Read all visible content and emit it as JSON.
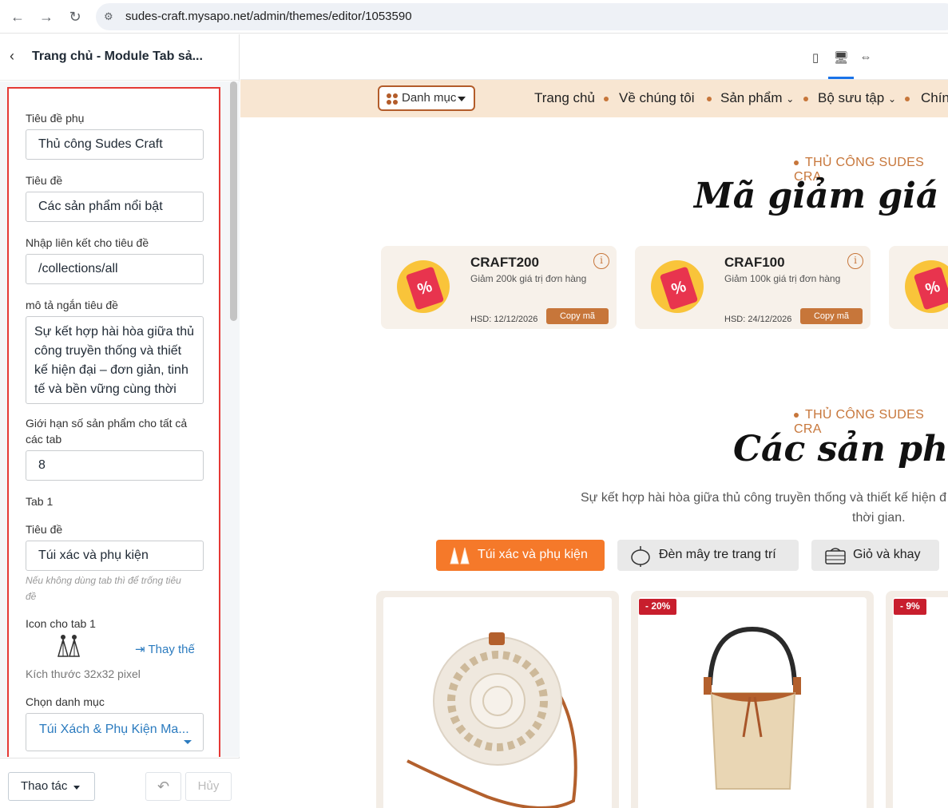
{
  "browser": {
    "url": "sudes-craft.mysapo.net/admin/themes/editor/1053590"
  },
  "panel": {
    "title": "Trang chủ - Module Tab sả...",
    "fields": {
      "subtitle_label": "Tiêu đề phụ",
      "subtitle_value": "Thủ công Sudes Craft",
      "title_label": "Tiêu đề",
      "title_value": "Các sản phẩm nổi bật",
      "link_label": "Nhập liên kết cho tiêu đề",
      "link_value": "/collections/all",
      "desc_label": "mô tả ngắn tiêu đề",
      "desc_value": "Sự kết hợp hài hòa giữa thủ công truyền thống và thiết kế hiện đại – đơn giản, tinh tế và bền vững cùng thời",
      "limit_label_1": "Giới hạn số sản phẩm cho tất cả",
      "limit_label_2": "các tab",
      "limit_value": "8",
      "tab1_heading": "Tab 1",
      "tab1_title_label": "Tiêu đề",
      "tab1_title_value": "Túi xác và phụ kiện",
      "tab1_hint_1": "Nếu không dùng tab thì để trống tiêu",
      "tab1_hint_2": "đề",
      "tab1_icon_label": "Icon cho tab 1",
      "replace_label": "Thay thế",
      "icon_size_hint": "Kích thước 32x32 pixel",
      "category_label": "Chọn danh mục",
      "category_value": "Túi Xách & Phụ Kiện Ma..."
    },
    "footer": {
      "actions_label": "Thao tác",
      "cancel_label": "Hủy"
    }
  },
  "site": {
    "nav": {
      "category_button": "Danh mục",
      "items": [
        "Trang chủ",
        "Về chúng tôi",
        "Sản phẩm",
        "Bộ sưu tập",
        "Chín"
      ]
    },
    "coupon_section": {
      "kicker": "THỦ CÔNG SUDES CRA",
      "title": "Mã giảm giá dành"
    },
    "coupons": [
      {
        "code": "CRAFT200",
        "desc": "Giảm 200k giá trị đơn hàng",
        "expiry": "HSD: 12/12/2026",
        "copy": "Copy mã"
      },
      {
        "code": "CRAF100",
        "desc": "Giảm 100k giá trị đơn hàng",
        "expiry": "HSD: 24/12/2026",
        "copy": "Copy mã"
      }
    ],
    "product_section": {
      "kicker": "THỦ CÔNG SUDES CRA",
      "title": "Các sản phẩm n",
      "desc_line1": "Sự kết hợp hài hòa giữa thủ công truyền thống và thiết kế hiện đ",
      "desc_line2": "thời gian."
    },
    "tabs": [
      "Túi xác và phụ kiện",
      "Đèn mây tre trang trí",
      "Giỏ và khay"
    ],
    "badges": [
      "- 20%",
      "- 9%"
    ]
  },
  "colors": {
    "accent": "#c7763a",
    "tab_active": "#f5792a",
    "highlight_border": "#e53935",
    "link": "#2b7bbf"
  }
}
